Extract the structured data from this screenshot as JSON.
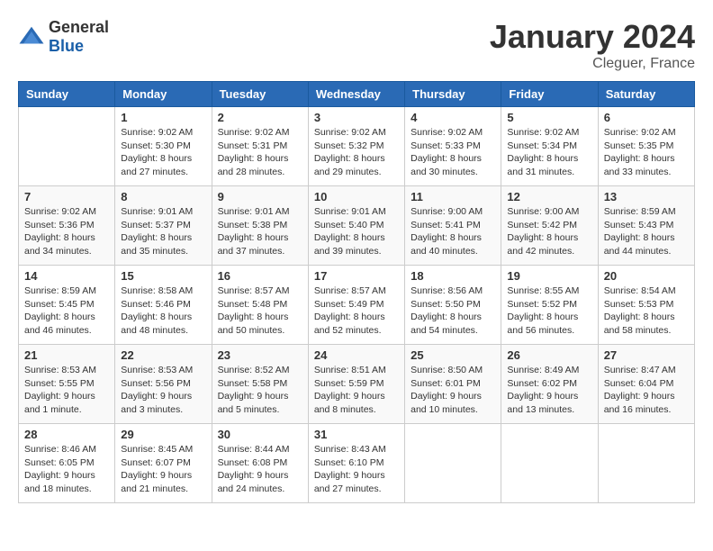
{
  "logo": {
    "general": "General",
    "blue": "Blue"
  },
  "header": {
    "title": "January 2024",
    "subtitle": "Cleguer, France"
  },
  "days_of_week": [
    "Sunday",
    "Monday",
    "Tuesday",
    "Wednesday",
    "Thursday",
    "Friday",
    "Saturday"
  ],
  "weeks": [
    [
      {
        "day": "",
        "info": ""
      },
      {
        "day": "1",
        "info": "Sunrise: 9:02 AM\nSunset: 5:30 PM\nDaylight: 8 hours\nand 27 minutes."
      },
      {
        "day": "2",
        "info": "Sunrise: 9:02 AM\nSunset: 5:31 PM\nDaylight: 8 hours\nand 28 minutes."
      },
      {
        "day": "3",
        "info": "Sunrise: 9:02 AM\nSunset: 5:32 PM\nDaylight: 8 hours\nand 29 minutes."
      },
      {
        "day": "4",
        "info": "Sunrise: 9:02 AM\nSunset: 5:33 PM\nDaylight: 8 hours\nand 30 minutes."
      },
      {
        "day": "5",
        "info": "Sunrise: 9:02 AM\nSunset: 5:34 PM\nDaylight: 8 hours\nand 31 minutes."
      },
      {
        "day": "6",
        "info": "Sunrise: 9:02 AM\nSunset: 5:35 PM\nDaylight: 8 hours\nand 33 minutes."
      }
    ],
    [
      {
        "day": "7",
        "info": "Sunrise: 9:02 AM\nSunset: 5:36 PM\nDaylight: 8 hours\nand 34 minutes."
      },
      {
        "day": "8",
        "info": "Sunrise: 9:01 AM\nSunset: 5:37 PM\nDaylight: 8 hours\nand 35 minutes."
      },
      {
        "day": "9",
        "info": "Sunrise: 9:01 AM\nSunset: 5:38 PM\nDaylight: 8 hours\nand 37 minutes."
      },
      {
        "day": "10",
        "info": "Sunrise: 9:01 AM\nSunset: 5:40 PM\nDaylight: 8 hours\nand 39 minutes."
      },
      {
        "day": "11",
        "info": "Sunrise: 9:00 AM\nSunset: 5:41 PM\nDaylight: 8 hours\nand 40 minutes."
      },
      {
        "day": "12",
        "info": "Sunrise: 9:00 AM\nSunset: 5:42 PM\nDaylight: 8 hours\nand 42 minutes."
      },
      {
        "day": "13",
        "info": "Sunrise: 8:59 AM\nSunset: 5:43 PM\nDaylight: 8 hours\nand 44 minutes."
      }
    ],
    [
      {
        "day": "14",
        "info": "Sunrise: 8:59 AM\nSunset: 5:45 PM\nDaylight: 8 hours\nand 46 minutes."
      },
      {
        "day": "15",
        "info": "Sunrise: 8:58 AM\nSunset: 5:46 PM\nDaylight: 8 hours\nand 48 minutes."
      },
      {
        "day": "16",
        "info": "Sunrise: 8:57 AM\nSunset: 5:48 PM\nDaylight: 8 hours\nand 50 minutes."
      },
      {
        "day": "17",
        "info": "Sunrise: 8:57 AM\nSunset: 5:49 PM\nDaylight: 8 hours\nand 52 minutes."
      },
      {
        "day": "18",
        "info": "Sunrise: 8:56 AM\nSunset: 5:50 PM\nDaylight: 8 hours\nand 54 minutes."
      },
      {
        "day": "19",
        "info": "Sunrise: 8:55 AM\nSunset: 5:52 PM\nDaylight: 8 hours\nand 56 minutes."
      },
      {
        "day": "20",
        "info": "Sunrise: 8:54 AM\nSunset: 5:53 PM\nDaylight: 8 hours\nand 58 minutes."
      }
    ],
    [
      {
        "day": "21",
        "info": "Sunrise: 8:53 AM\nSunset: 5:55 PM\nDaylight: 9 hours\nand 1 minute."
      },
      {
        "day": "22",
        "info": "Sunrise: 8:53 AM\nSunset: 5:56 PM\nDaylight: 9 hours\nand 3 minutes."
      },
      {
        "day": "23",
        "info": "Sunrise: 8:52 AM\nSunset: 5:58 PM\nDaylight: 9 hours\nand 5 minutes."
      },
      {
        "day": "24",
        "info": "Sunrise: 8:51 AM\nSunset: 5:59 PM\nDaylight: 9 hours\nand 8 minutes."
      },
      {
        "day": "25",
        "info": "Sunrise: 8:50 AM\nSunset: 6:01 PM\nDaylight: 9 hours\nand 10 minutes."
      },
      {
        "day": "26",
        "info": "Sunrise: 8:49 AM\nSunset: 6:02 PM\nDaylight: 9 hours\nand 13 minutes."
      },
      {
        "day": "27",
        "info": "Sunrise: 8:47 AM\nSunset: 6:04 PM\nDaylight: 9 hours\nand 16 minutes."
      }
    ],
    [
      {
        "day": "28",
        "info": "Sunrise: 8:46 AM\nSunset: 6:05 PM\nDaylight: 9 hours\nand 18 minutes."
      },
      {
        "day": "29",
        "info": "Sunrise: 8:45 AM\nSunset: 6:07 PM\nDaylight: 9 hours\nand 21 minutes."
      },
      {
        "day": "30",
        "info": "Sunrise: 8:44 AM\nSunset: 6:08 PM\nDaylight: 9 hours\nand 24 minutes."
      },
      {
        "day": "31",
        "info": "Sunrise: 8:43 AM\nSunset: 6:10 PM\nDaylight: 9 hours\nand 27 minutes."
      },
      {
        "day": "",
        "info": ""
      },
      {
        "day": "",
        "info": ""
      },
      {
        "day": "",
        "info": ""
      }
    ]
  ]
}
